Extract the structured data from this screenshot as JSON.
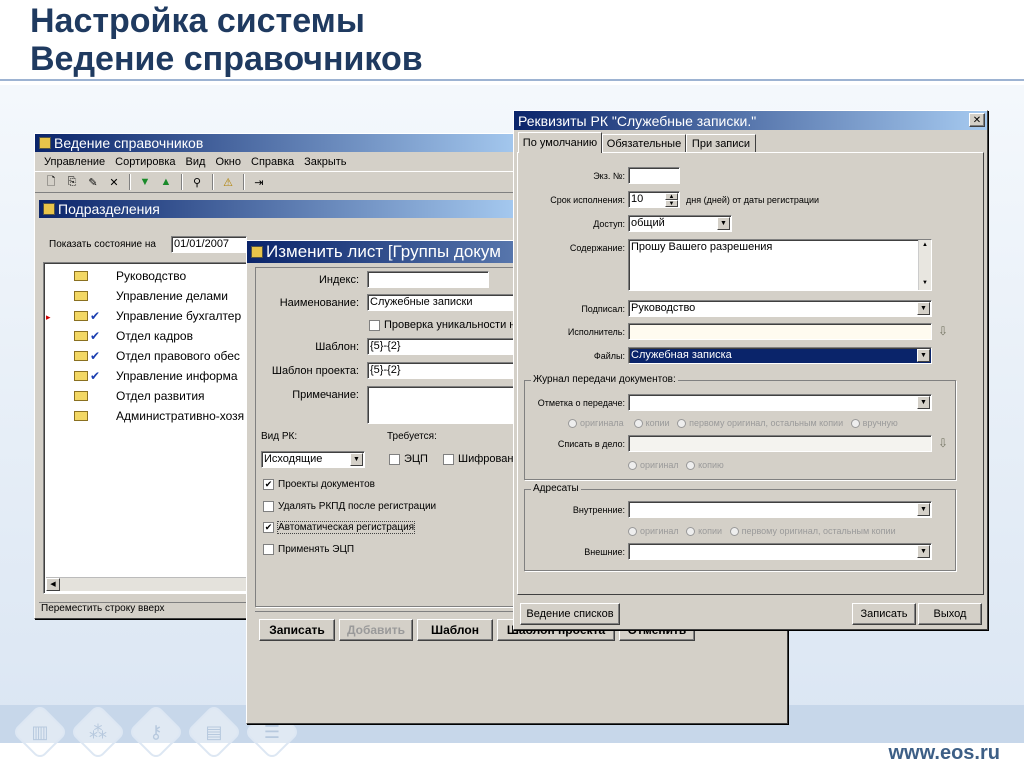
{
  "slide": {
    "title_line1": "Настройка системы",
    "title_line2": "Ведение справочников",
    "footer_url": "www.eos.ru"
  },
  "win1": {
    "title": "Ведение справочников",
    "menu": [
      "Управление",
      "Сортировка",
      "Вид",
      "Окно",
      "Справка",
      "Закрыть"
    ],
    "toolbar_icons": [
      "new-icon",
      "copy-icon",
      "edit-icon",
      "delete-icon",
      "move-down-icon",
      "move-up-icon",
      "find-icon",
      "filter-icon",
      "exit-icon"
    ],
    "subwin_title": "Подразделения",
    "show_state_label": "Показать состояние на",
    "show_state_date": "01/01/2007",
    "tree": [
      {
        "label": "Руководство",
        "checked": false
      },
      {
        "label": "Управление делами",
        "checked": false
      },
      {
        "label": "Управление бухгалтер",
        "checked": true
      },
      {
        "label": "Отдел кадров",
        "checked": true
      },
      {
        "label": "Отдел правового обес",
        "checked": true
      },
      {
        "label": "Управление информа",
        "checked": true
      },
      {
        "label": "Отдел развития",
        "checked": false
      },
      {
        "label": "Административно-хозя",
        "checked": false
      }
    ],
    "status": "Переместить строку вверх"
  },
  "win2": {
    "title": "Изменить лист [Группы докум",
    "index_label": "Индекс:",
    "index_value": "",
    "name_label": "Наименование:",
    "name_value": "Служебные записки",
    "uniq_check": "Проверка уникальности н",
    "template_label": "Шаблон:",
    "template_value": "{5}-{2}",
    "proj_template_label": "Шаблон проекта:",
    "proj_template_value": "{5}-{2}",
    "note_label": "Примечание:",
    "rk_label": "Вид РК:",
    "rk_value": "Исходящие",
    "req_label": "Требуется:",
    "ecp_check": "ЭЦП",
    "cipher_check": "Шифрован",
    "checks": [
      {
        "label": "Проекты документов",
        "checked": true
      },
      {
        "label": "Удалять РКПД после регистрации",
        "checked": false
      },
      {
        "label": "Автоматическая регистрация",
        "checked": true
      },
      {
        "label": "Применять ЭЦП",
        "checked": false
      }
    ],
    "buttons": [
      "Записать",
      "Добавить",
      "Шаблон",
      "Шаблон проекта",
      "Отменить"
    ]
  },
  "win3": {
    "title": "Реквизиты РК \"Служебные записки.\"",
    "close_glyph": "✕",
    "tabs": [
      "По умолчанию",
      "Обязательные",
      "При записи"
    ],
    "copy_label": "Экз. №:",
    "copy_value": "",
    "due_label": "Срок исполнения:",
    "due_value": "10",
    "due_suffix": "дня (дней) от даты регистрации",
    "access_label": "Доступ:",
    "access_value": "общий",
    "content_label": "Содержание:",
    "content_value": "Прошу Вашего разрешения",
    "signed_label": "Подписал:",
    "signed_value": "Руководство",
    "exec_label": "Исполнитель:",
    "exec_value": "",
    "files_label": "Файлы:",
    "files_value": "Служебная записка",
    "journal_group": "Журнал передачи документов:",
    "transfer_label": "Отметка о передаче:",
    "transfer_options": [
      "оригинала",
      "копии",
      "первому оригинал, остальным копии",
      "вручную"
    ],
    "writeoff_label": "Списать в дело:",
    "writeoff_options": [
      "оригинал",
      "копию"
    ],
    "addressees_group": "Адресаты",
    "internal_label": "Внутренние:",
    "internal_options": [
      "оригинал",
      "копии",
      "первому оригинал, остальным копии"
    ],
    "external_label": "Внешние:",
    "buttons": {
      "lists": "Ведение списков",
      "save": "Записать",
      "exit": "Выход"
    }
  }
}
